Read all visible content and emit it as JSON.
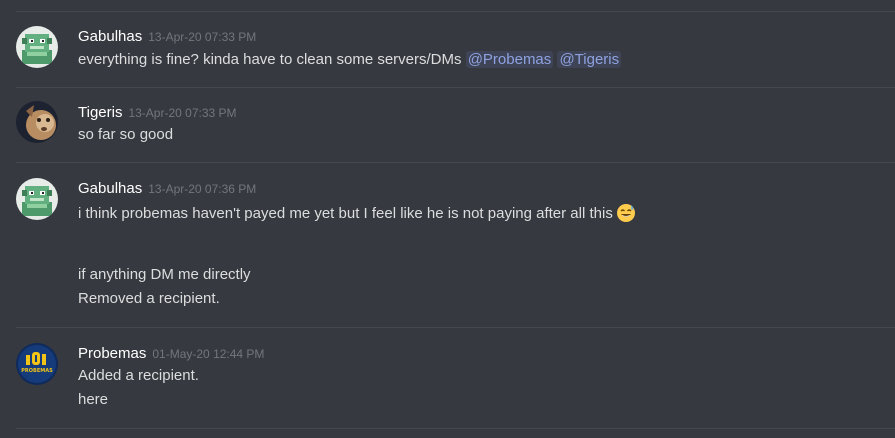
{
  "messages": [
    {
      "author": "Gabulhas",
      "timestamp": "13-Apr-20 07:33 PM",
      "text": "everything is fine? kinda have to clean some servers/DMs",
      "mentions": [
        "@Probemas",
        "@Tigeris"
      ]
    },
    {
      "author": "Tigeris",
      "timestamp": "13-Apr-20 07:33 PM",
      "text": "so far so good"
    },
    {
      "author": "Gabulhas",
      "timestamp": "13-Apr-20 07:36 PM",
      "lines": [
        "i think probemas haven't payed me yet but I feel like he is not paying after all this",
        "if anything DM me directly",
        "Removed a recipient."
      ]
    },
    {
      "author": "Probemas",
      "timestamp": "01-May-20 12:44 PM",
      "lines": [
        "Added a recipient.",
        "here"
      ]
    }
  ],
  "avatars": {
    "gabulhas": "pixel-dragon-avatar",
    "tigeris": "cat-photo-avatar",
    "probemas": "probemas-logo-avatar"
  },
  "emojis": [
    "sweat-smile-emoji"
  ],
  "colors": {
    "background": "#36393f",
    "username": "#ffffff",
    "message_text": "#dcddde",
    "timestamp": "#72767d",
    "mention": "#8ea1e1",
    "divider": "#44474d"
  },
  "avatar_logo_text": "PROBEMAS"
}
